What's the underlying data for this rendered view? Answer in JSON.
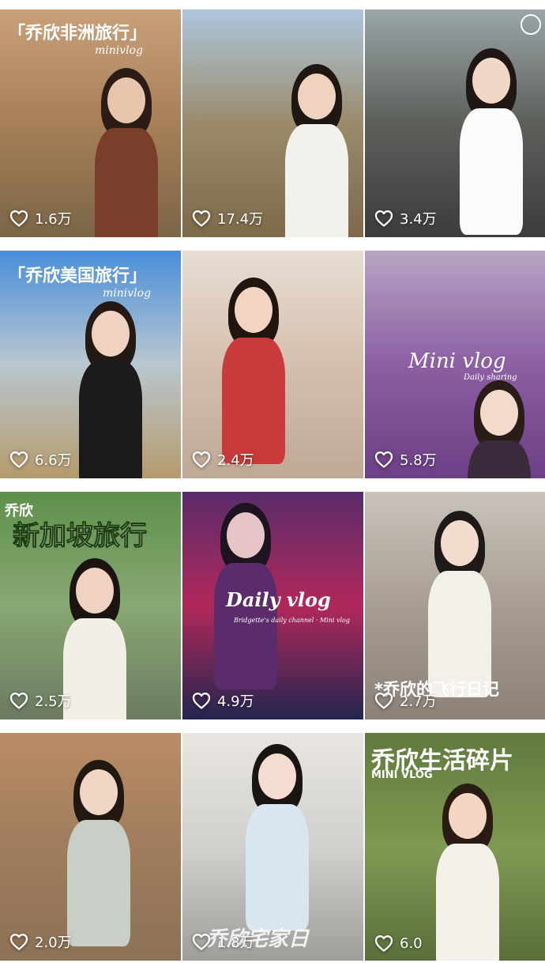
{
  "tiles": [
    {
      "title": "「乔欣非洲旅行」",
      "subtitle": "minivlog",
      "likes": "1.6万",
      "colors": {
        "top": "#c8a07a",
        "mid": "#a67f58",
        "bottom": "#7a6647",
        "accent": "#f0c36a"
      }
    },
    {
      "title": "",
      "subtitle": "",
      "likes": "17.4万",
      "colors": {
        "top": "#aec6dd",
        "mid": "#9a8b6a",
        "bottom": "#7c6a48",
        "accent": "#d9cbb5"
      }
    },
    {
      "title": "",
      "subtitle": "",
      "likes": "3.4万",
      "colors": {
        "top": "#9aa6a8",
        "mid": "#5c5f5a",
        "bottom": "#3b3d3c",
        "accent": "#e9e4dc"
      }
    },
    {
      "title": "「乔欣美国旅行」",
      "subtitle": "minivlog",
      "likes": "6.6万",
      "colors": {
        "top": "#4a8ed8",
        "mid": "#b9c7cf",
        "bottom": "#b59a6c",
        "accent": "#f4c443"
      }
    },
    {
      "title": "",
      "subtitle": "",
      "likes": "2.4万",
      "colors": {
        "top": "#e8ddd3",
        "mid": "#d4bfae",
        "bottom": "#bfa995",
        "accent": "#c93a3a"
      }
    },
    {
      "title": "Mini vlog",
      "subtitle": "Daily sharing",
      "likes": "5.8万",
      "colors": {
        "top": "#b7a4c4",
        "mid": "#8c5fa3",
        "bottom": "#6c3f86",
        "accent": "#e88ab5"
      }
    },
    {
      "title": "新加坡旅行",
      "subtitle": "乔欣",
      "likes": "2.5万",
      "colors": {
        "top": "#5f8f4c",
        "mid": "#88a874",
        "bottom": "#6c7a60",
        "accent": "#f7f1dc"
      }
    },
    {
      "title": "Daily vlog",
      "subtitle": "Bridgette's daily channel · Mini vlog",
      "likes": "4.9万",
      "colors": {
        "top": "#5a2c6b",
        "mid": "#b0285a",
        "bottom": "#23264f",
        "accent": "#ff6a5c"
      }
    },
    {
      "title": "*乔欣的飞行日记",
      "subtitle": "",
      "likes": "2.7万",
      "colors": {
        "top": "#c9c3bb",
        "mid": "#a89d93",
        "bottom": "#8c8178",
        "accent": "#2b2b2b"
      }
    },
    {
      "title": "",
      "subtitle": "",
      "likes": "2.0万",
      "colors": {
        "top": "#b98d66",
        "mid": "#a07c5d",
        "bottom": "#8c7256",
        "accent": "#d8dbd2"
      }
    },
    {
      "title": "乔欣宅家日",
      "subtitle": "",
      "likes": "1.8万",
      "colors": {
        "top": "#e9e6e1",
        "mid": "#d1d0cd",
        "bottom": "#9f9e9b",
        "accent": "#c8dbe6"
      }
    },
    {
      "title": "乔欣生活碎片",
      "subtitle": "MINI VLOG",
      "likes": "6.0",
      "colors": {
        "top": "#5f7a3c",
        "mid": "#7f9952",
        "bottom": "#5b6f3b",
        "accent": "#f2ece3"
      }
    }
  ]
}
